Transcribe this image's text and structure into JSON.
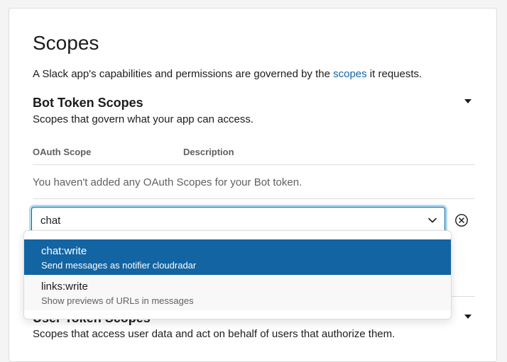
{
  "scopes": {
    "title": "Scopes",
    "intro_before": "A Slack app's capabilities and permissions are governed by the ",
    "intro_link": "scopes",
    "intro_after": " it requests."
  },
  "bot_scopes": {
    "title": "Bot Token Scopes",
    "description": "Scopes that govern what your app can access.",
    "columns": [
      "OAuth Scope",
      "Description"
    ],
    "empty_message": "You haven't added any OAuth Scopes for your Bot token.",
    "search_value": "chat",
    "options": [
      {
        "name": "chat:write",
        "description": "Send messages as notifier cloudradar",
        "selected": true
      },
      {
        "name": "links:write",
        "description": "Show previews of URLs in messages",
        "selected": false
      }
    ]
  },
  "user_scopes": {
    "title": "User Token Scopes",
    "description": "Scopes that access user data and act on behalf of users that authorize them."
  },
  "colors": {
    "accent": "#1264a3",
    "link": "#1264a3",
    "text": "#1d1c1d",
    "muted": "#616061"
  },
  "icons": {
    "section_toggle": "caret-down-icon",
    "input_toggle": "chevron-down-icon",
    "clear": "circle-x-icon"
  }
}
